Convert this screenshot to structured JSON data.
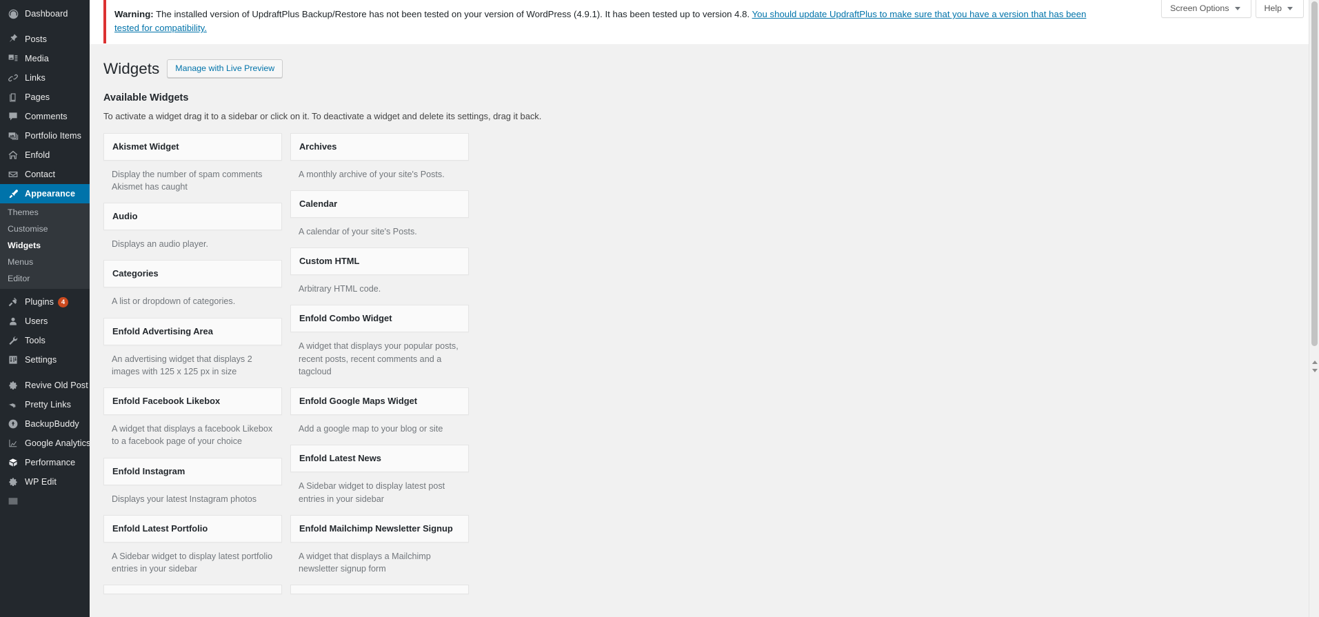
{
  "sidebar": {
    "items": [
      {
        "label": "Dashboard",
        "icon": "dashboard-icon",
        "current": false,
        "badge": null
      },
      {
        "label": "Posts",
        "icon": "pin-icon",
        "current": false,
        "badge": null
      },
      {
        "label": "Media",
        "icon": "media-icon",
        "current": false,
        "badge": null
      },
      {
        "label": "Links",
        "icon": "link-icon",
        "current": false,
        "badge": null
      },
      {
        "label": "Pages",
        "icon": "page-icon",
        "current": false,
        "badge": null
      },
      {
        "label": "Comments",
        "icon": "comment-icon",
        "current": false,
        "badge": null
      },
      {
        "label": "Portfolio Items",
        "icon": "portfolio-icon",
        "current": false,
        "badge": null
      },
      {
        "label": "Enfold",
        "icon": "home-icon",
        "current": false,
        "badge": null
      },
      {
        "label": "Contact",
        "icon": "envelope-icon",
        "current": false,
        "badge": null
      },
      {
        "label": "Appearance",
        "icon": "brush-icon",
        "current": true,
        "badge": null
      },
      {
        "label": "Plugins",
        "icon": "plug-icon",
        "current": false,
        "badge": "4"
      },
      {
        "label": "Users",
        "icon": "user-icon",
        "current": false,
        "badge": null
      },
      {
        "label": "Tools",
        "icon": "wrench-icon",
        "current": false,
        "badge": null
      },
      {
        "label": "Settings",
        "icon": "settings-icon",
        "current": false,
        "badge": null
      },
      {
        "label": "Revive Old Post",
        "icon": "gear-icon",
        "current": false,
        "badge": null
      },
      {
        "label": "Pretty Links",
        "icon": "pretty-links-icon",
        "current": false,
        "badge": null
      },
      {
        "label": "BackupBuddy",
        "icon": "backupbuddy-icon",
        "current": false,
        "badge": null
      },
      {
        "label": "Google Analytics",
        "icon": "chart-icon",
        "current": false,
        "badge": null
      },
      {
        "label": "Performance",
        "icon": "performance-icon",
        "current": false,
        "badge": null
      },
      {
        "label": "WP Edit",
        "icon": "gear-icon",
        "current": false,
        "badge": null
      }
    ],
    "appearance_submenu": [
      {
        "label": "Themes",
        "current": false
      },
      {
        "label": "Customise",
        "current": false
      },
      {
        "label": "Widgets",
        "current": true
      },
      {
        "label": "Menus",
        "current": false
      },
      {
        "label": "Editor",
        "current": false
      }
    ]
  },
  "screen_meta": {
    "screen_options_label": "Screen Options",
    "help_label": "Help"
  },
  "notice": {
    "bold_prefix": "Warning:",
    "text": " The installed version of UpdraftPlus Backup/Restore has not been tested on your version of WordPress (4.9.1). It has been tested up to version 4.8. ",
    "link_text": "You should update UpdraftPlus to make sure that you have a version that has been tested for compatibility.",
    "accent_color": "#dc3232"
  },
  "header": {
    "page_title": "Widgets",
    "live_preview_button": "Manage with Live Preview"
  },
  "available_widgets": {
    "section_title": "Available Widgets",
    "section_description": "To activate a widget drag it to a sidebar or click on it. To deactivate a widget and delete its settings, drag it back.",
    "left_column": [
      {
        "name": "Akismet Widget",
        "description": "Display the number of spam comments Akismet has caught"
      },
      {
        "name": "Audio",
        "description": "Displays an audio player."
      },
      {
        "name": "Categories",
        "description": "A list or dropdown of categories."
      },
      {
        "name": "Enfold Advertising Area",
        "description": "An advertising widget that displays 2 images with 125 x 125 px in size"
      },
      {
        "name": "Enfold Facebook Likebox",
        "description": "A widget that displays a facebook Likebox to a facebook page of your choice"
      },
      {
        "name": "Enfold Instagram",
        "description": "Displays your latest Instagram photos"
      },
      {
        "name": "Enfold Latest Portfolio",
        "description": "A Sidebar widget to display latest portfolio entries in your sidebar"
      }
    ],
    "right_column": [
      {
        "name": "Archives",
        "description": "A monthly archive of your site's Posts."
      },
      {
        "name": "Calendar",
        "description": "A calendar of your site's Posts."
      },
      {
        "name": "Custom HTML",
        "description": "Arbitrary HTML code."
      },
      {
        "name": "Enfold Combo Widget",
        "description": "A widget that displays your popular posts, recent posts, recent comments and a tagcloud"
      },
      {
        "name": "Enfold Google Maps Widget",
        "description": "Add a google map to your blog or site"
      },
      {
        "name": "Enfold Latest News",
        "description": "A Sidebar widget to display latest post entries in your sidebar"
      },
      {
        "name": "Enfold Mailchimp Newsletter Signup",
        "description": "A widget that displays a Mailchimp newsletter signup form"
      }
    ]
  },
  "colors": {
    "admin_bg": "#23282d",
    "submenu_bg": "#32373c",
    "accent_blue": "#0073aa",
    "badge_orange": "#ca4a1f",
    "content_bg": "#f1f1f1",
    "notice_red": "#dc3232"
  }
}
